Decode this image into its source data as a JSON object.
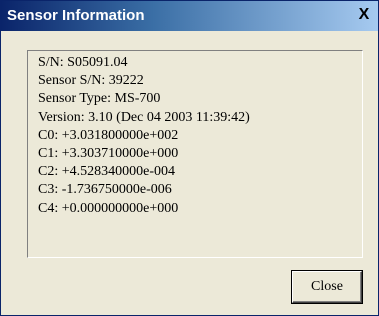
{
  "window": {
    "title": "Sensor Information",
    "close_glyph": "X"
  },
  "info": {
    "lines": [
      "S/N: S05091.04",
      "Sensor S/N: 39222",
      "Sensor Type: MS-700",
      "Version: 3.10 (Dec 04 2003 11:39:42)",
      "C0: +3.031800000e+002",
      "C1: +3.303710000e+000",
      "C2: +4.528340000e-004",
      "C3: -1.736750000e-006",
      "C4: +0.000000000e+000"
    ]
  },
  "buttons": {
    "close_label": "Close"
  },
  "colors": {
    "titlebar_start": "#0a246a",
    "titlebar_end": "#a6caf0",
    "dialog_background": "#ece9d8"
  }
}
